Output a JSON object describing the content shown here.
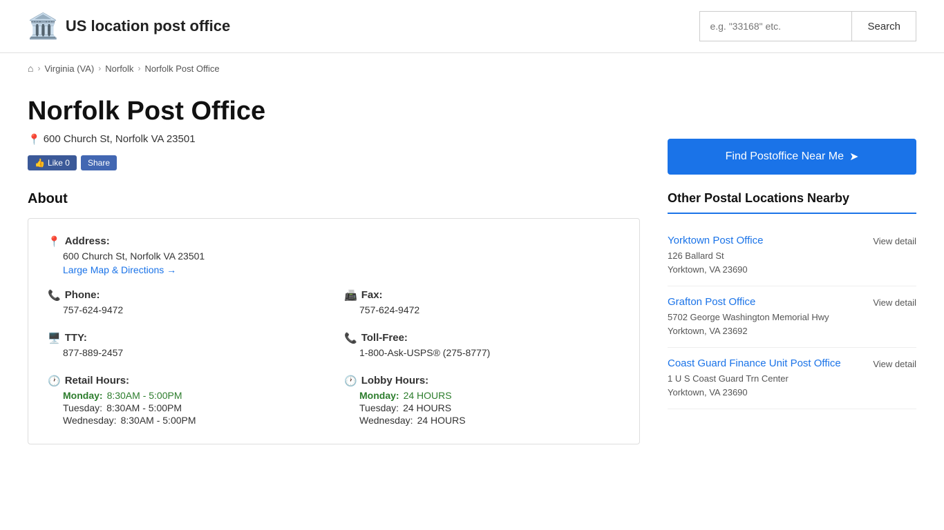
{
  "header": {
    "logo_icon": "🏛️",
    "title": "US location post office",
    "search_placeholder": "e.g. \"33168\" etc.",
    "search_button": "Search"
  },
  "breadcrumb": {
    "home_icon": "⌂",
    "items": [
      {
        "label": "Virginia (VA)",
        "href": "#"
      },
      {
        "label": "Norfolk",
        "href": "#"
      },
      {
        "label": "Norfolk Post Office",
        "href": "#"
      }
    ]
  },
  "main": {
    "page_title": "Norfolk Post Office",
    "address": "600 Church St, Norfolk VA 23501",
    "social": {
      "like": "Like 0",
      "share": "Share"
    },
    "about_title": "About",
    "address_label": "Address:",
    "address_value": "600 Church St, Norfolk VA 23501",
    "directions_link": "Large Map & Directions →",
    "phone_label": "Phone:",
    "phone_value": "757-624-9472",
    "fax_label": "Fax:",
    "fax_value": "757-624-9472",
    "tty_label": "TTY:",
    "tty_value": "877-889-2457",
    "tollfree_label": "Toll-Free:",
    "tollfree_value": "1-800-Ask-USPS® (275-8777)",
    "retail_hours_label": "Retail Hours:",
    "retail_hours": [
      {
        "day": "Monday:",
        "hours": "8:30AM - 5:00PM",
        "today": true
      },
      {
        "day": "Tuesday:",
        "hours": "8:30AM - 5:00PM",
        "today": false
      },
      {
        "day": "Wednesday:",
        "hours": "8:30AM - 5:00PM",
        "today": false
      }
    ],
    "lobby_hours_label": "Lobby Hours:",
    "lobby_hours": [
      {
        "day": "Monday:",
        "hours": "24 HOURS",
        "today": true
      },
      {
        "day": "Tuesday:",
        "hours": "24 HOURS",
        "today": false
      },
      {
        "day": "Wednesday:",
        "hours": "24 HOURS",
        "today": false
      }
    ]
  },
  "sidebar": {
    "find_btn": "Find Postoffice Near Me",
    "nearby_title": "Other Postal Locations Nearby",
    "nearby_items": [
      {
        "name": "Yorktown Post Office",
        "addr_line1": "126 Ballard St",
        "addr_line2": "Yorktown, VA 23690",
        "view_detail": "View detail"
      },
      {
        "name": "Grafton Post Office",
        "addr_line1": "5702 George Washington Memorial",
        "addr_line2": "Hwy",
        "addr_line3": "Yorktown, VA 23692",
        "view_detail": "View detail"
      },
      {
        "name": "Coast Guard Finance Unit Post Office",
        "addr_line1": "1 U S Coast Guard Trn Center",
        "addr_line2": "Yorktown, VA 23690",
        "view_detail": "View detail"
      }
    ]
  }
}
